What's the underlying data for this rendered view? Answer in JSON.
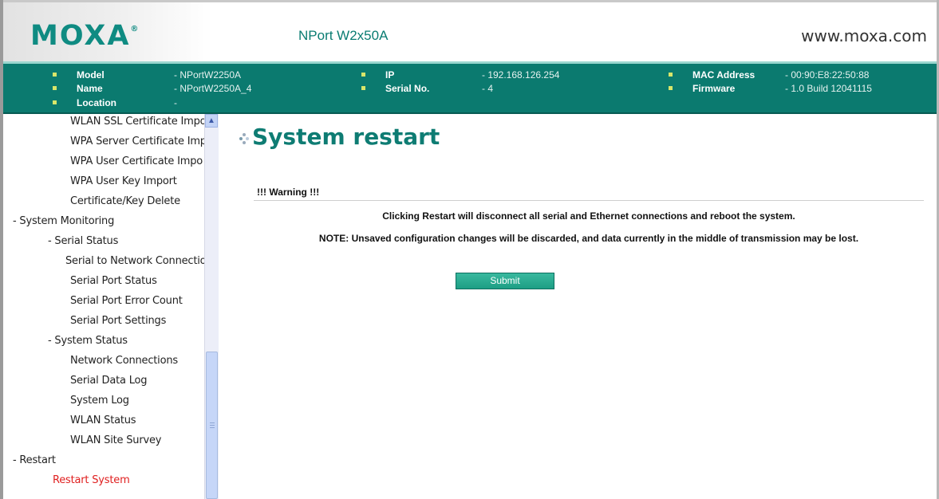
{
  "header": {
    "logo_text": "MOXA",
    "logo_mark": "®",
    "product": "NPort W2x50A",
    "website": "www.moxa.com"
  },
  "info": {
    "model_label": "Model",
    "model_value": "- NPortW2250A",
    "name_label": "Name",
    "name_value": "- NPortW2250A_4",
    "location_label": "Location",
    "location_value": "-",
    "ip_label": "IP",
    "ip_value": "- 192.168.126.254",
    "serial_label": "Serial No.",
    "serial_value": "- 4",
    "mac_label": "MAC Address",
    "mac_value": "- 00:90:E8:22:50:88",
    "firmware_label": "Firmware",
    "firmware_value": "- 1.0 Build 12041115",
    "bullet_color": "#d8e66a",
    "band_color": "#0b7a6f"
  },
  "sidebar": {
    "items": [
      "WLAN SSL Certificate Impo",
      "WPA Server Certificate Imp",
      "WPA User Certificate Impo",
      "WPA User Key Import",
      "Certificate/Key Delete",
      "- System Monitoring",
      "- Serial Status",
      "Serial to Network Connectio",
      "Serial Port Status",
      "Serial Port Error Count",
      "Serial Port Settings",
      "- System Status",
      "Network Connections",
      "Serial Data Log",
      "System Log",
      "WLAN Status",
      "WLAN Site Survey",
      "- Restart",
      "Restart System"
    ],
    "active_item": "Restart System",
    "active_color": "#e02020"
  },
  "main": {
    "title": "System restart",
    "warning_title": "!!! Warning !!!",
    "message1": "Clicking Restart will disconnect all serial and Ethernet connections and reboot the system.",
    "message2": "NOTE: Unsaved configuration changes will be discarded, and data currently in the middle of transmission may be lost.",
    "submit_label": "Submit",
    "accent_color": "#0e7c73"
  }
}
